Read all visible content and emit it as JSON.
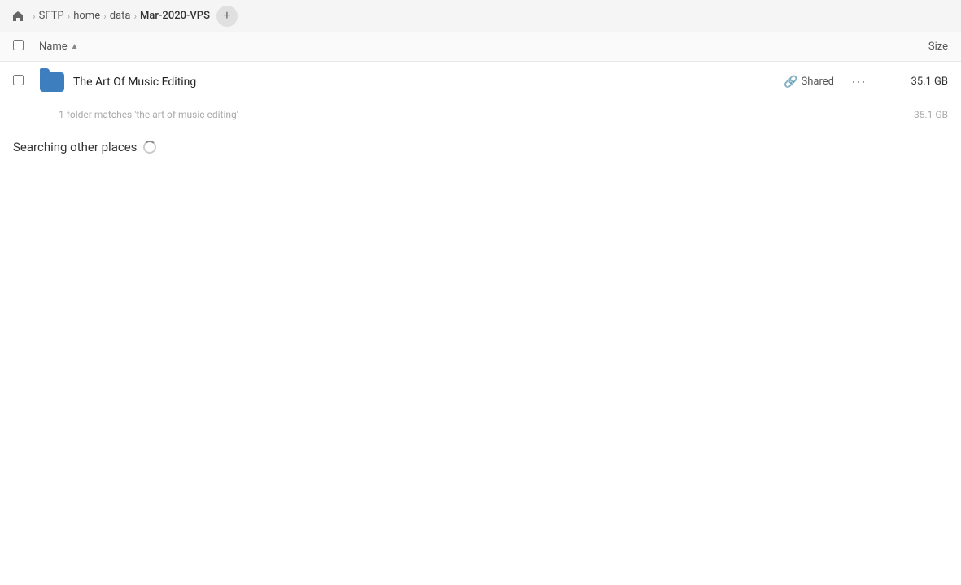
{
  "breadcrumb": {
    "home_icon": "🏠",
    "items": [
      {
        "label": "SFTP",
        "active": false
      },
      {
        "label": "home",
        "active": false
      },
      {
        "label": "data",
        "active": false
      },
      {
        "label": "Mar-2020-VPS",
        "active": true
      }
    ],
    "add_tab_label": "+"
  },
  "columns": {
    "name_label": "Name",
    "size_label": "Size"
  },
  "file_row": {
    "name": "The Art Of Music Editing",
    "shared_label": "Shared",
    "size": "35.1 GB"
  },
  "match_info": {
    "text": "1 folder matches 'the art of music editing'",
    "size": "35.1 GB"
  },
  "searching": {
    "label": "Searching other places"
  }
}
